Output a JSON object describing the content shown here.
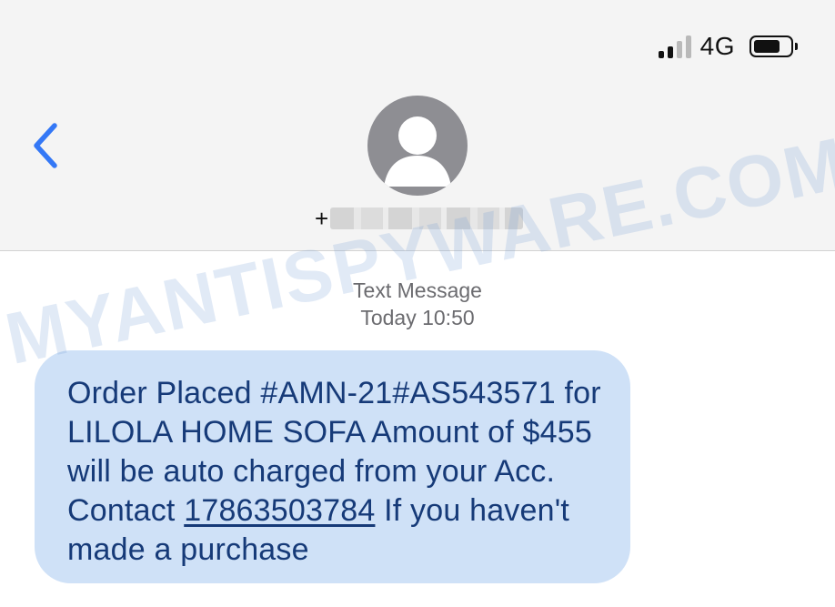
{
  "status_bar": {
    "network": "4G",
    "signal_bars_filled": 2,
    "signal_bars_total": 4,
    "icons": [
      "signal-icon",
      "battery-icon"
    ]
  },
  "header": {
    "back_icon": "chevron-left-icon",
    "avatar_icon": "person-silhouette-icon",
    "contact_prefix": "+"
  },
  "message_meta": {
    "type_label": "Text Message",
    "timestamp": "Today 10:50"
  },
  "message": {
    "text_before_link": "Order Placed #AMN-21#AS543571 for LILOLA HOME SOFA Amount of $455 will be auto charged from your Acc. Contact ",
    "phone_link": "17863503784",
    "text_after_link": " If you haven't made a purchase"
  },
  "watermark": "MYANTISPYWARE.COM",
  "colors": {
    "accent": "#3478f6",
    "bubble": "#cfe1f7",
    "bubble_text": "#163a78",
    "header_bg": "#f4f4f4",
    "avatar": "#8e8e93"
  }
}
